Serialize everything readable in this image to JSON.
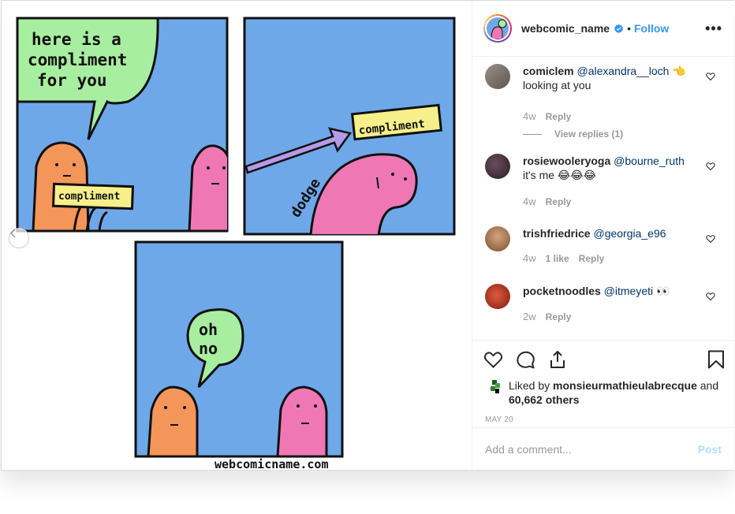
{
  "comic": {
    "panel1_bubble_lines": [
      "here is a",
      "compliment",
      "for you"
    ],
    "panel1_card": "compliment",
    "panel2_card": "compliment",
    "panel2_dodge": "dodge",
    "panel3_bubble_lines": [
      "oh",
      "no"
    ],
    "credit": "webcomicname.com"
  },
  "post": {
    "username": "webcomic_name",
    "verified": true,
    "separator": "•",
    "follow_label": "Follow",
    "more_label": "•••",
    "verified_icon": "verified-badge-icon"
  },
  "comments": [
    {
      "user": "comiclem",
      "mention": "@alexandra__loch",
      "emoji": "👈",
      "text": "looking at you",
      "time": "4w",
      "reply_label": "Reply",
      "view_replies": "View replies (1)",
      "avatar_color": "#8a8178"
    },
    {
      "user": "rosiewooleryoga",
      "mention": "@bourne_ruth",
      "text": "it's me 😂😂😂",
      "time": "4w",
      "reply_label": "Reply",
      "avatar_color": "#3b2a33"
    },
    {
      "user": "trishfriedrice",
      "mention": "@georgia_e96",
      "text": "",
      "time": "4w",
      "likes": "1 like",
      "reply_label": "Reply",
      "avatar_color": "#b07b5a"
    },
    {
      "user": "pocketnoodles",
      "mention": "@itmeyeti",
      "emoji": "👀",
      "text": "",
      "time": "2w",
      "reply_label": "Reply",
      "avatar_color": "#c0392b"
    }
  ],
  "likes": {
    "prefix": "Liked by",
    "liker": "monsieurmathieulabrecque",
    "conj": "and",
    "others": "60,662 others"
  },
  "date": "MAY 20",
  "add_comment": {
    "placeholder": "Add a comment...",
    "post_label": "Post"
  },
  "colors": {
    "accent": "#3897f0",
    "panel_blue": "#6fa8e8",
    "bubble_green": "#a8eea0",
    "blob_orange": "#f4955a",
    "blob_pink": "#ef78b4",
    "card_yellow": "#f6ef8a",
    "arrow_purple": "#b39be8"
  }
}
